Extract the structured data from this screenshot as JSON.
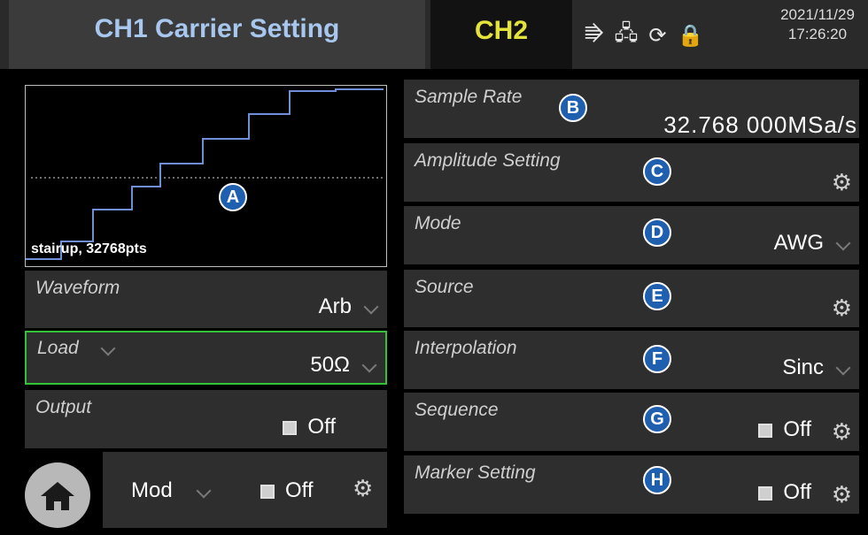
{
  "header": {
    "title": "CH1 Carrier Setting",
    "ch2_tab": "CH2",
    "date": "2021/11/29",
    "time": "17:26:20"
  },
  "status_icons": [
    "usb-icon",
    "network-icon",
    "refresh-icon",
    "lock-icon"
  ],
  "preview": {
    "caption": "stairup, 32768pts",
    "badge": "A"
  },
  "left_panels": {
    "waveform": {
      "label": "Waveform",
      "value": "Arb"
    },
    "load": {
      "label": "Load",
      "value": "50Ω"
    },
    "output": {
      "label": "Output",
      "state": "Off"
    },
    "mod": {
      "label": "Mod",
      "state": "Off"
    }
  },
  "right_panels": {
    "sample_rate": {
      "label": "Sample Rate",
      "value": "32.768 000MSa/s",
      "badge": "B"
    },
    "amplitude": {
      "label": "Amplitude Setting",
      "badge": "C"
    },
    "mode": {
      "label": "Mode",
      "value": "AWG",
      "badge": "D"
    },
    "source": {
      "label": "Source",
      "badge": "E"
    },
    "interpolation": {
      "label": "Interpolation",
      "value": "Sinc",
      "badge": "F"
    },
    "sequence": {
      "label": "Sequence",
      "state": "Off",
      "badge": "G"
    },
    "marker": {
      "label": "Marker Setting",
      "state": "Off",
      "badge": "H"
    }
  },
  "colors": {
    "title_blue": "#a8c7ee",
    "ch2_yellow": "#e3e33c",
    "waveform_blue": "#6f8fd8",
    "load_border": "#35c23a",
    "badge_blue": "#1f5fb0"
  }
}
